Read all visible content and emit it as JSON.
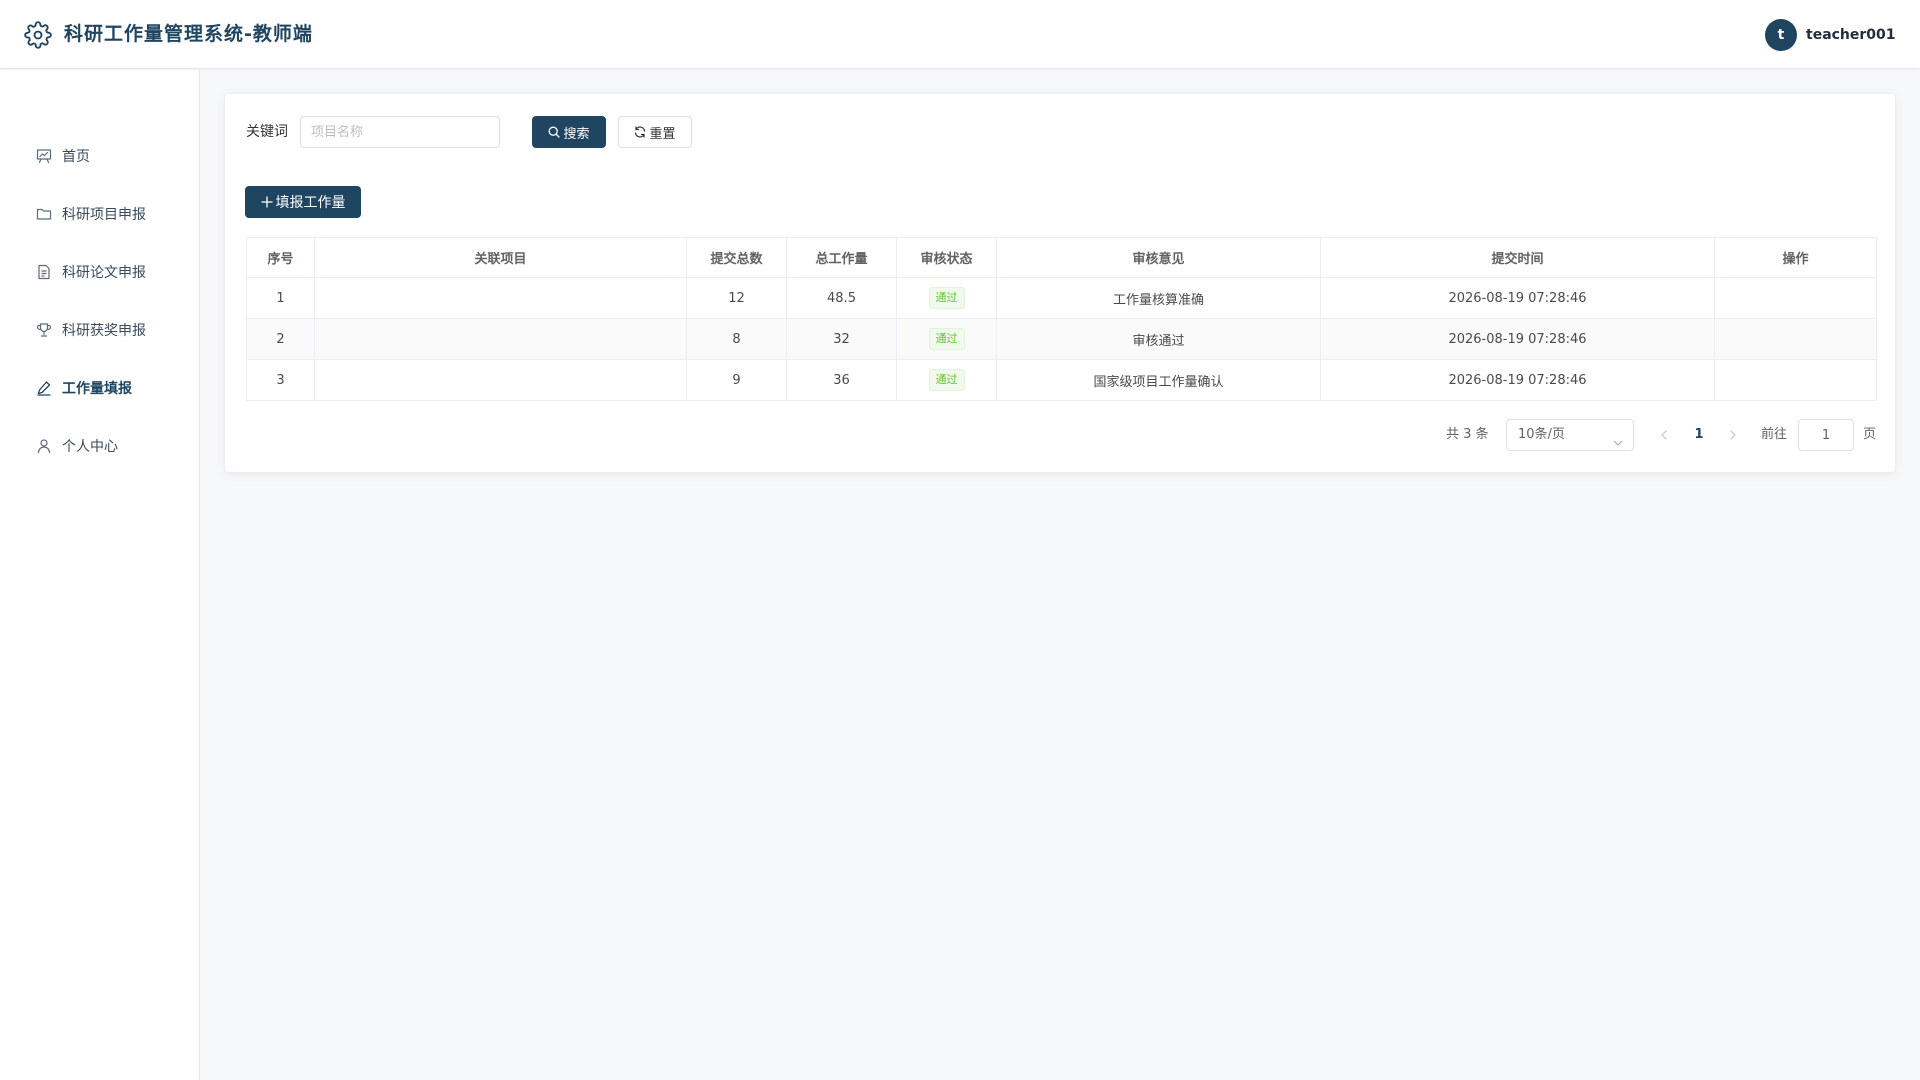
{
  "header": {
    "title": "科研工作量管理系统-教师端",
    "avatar_initial": "t",
    "username": "teacher001"
  },
  "sidebar": {
    "items": [
      {
        "label": "首页",
        "icon": "presentation-chart-icon"
      },
      {
        "label": "科研项目申报",
        "icon": "folder-icon"
      },
      {
        "label": "科研论文申报",
        "icon": "document-icon"
      },
      {
        "label": "科研获奖申报",
        "icon": "trophy-icon"
      },
      {
        "label": "工作量填报",
        "icon": "edit-pen-icon",
        "active": true
      },
      {
        "label": "个人中心",
        "icon": "user-icon"
      }
    ]
  },
  "search": {
    "label": "关键词",
    "placeholder": "项目名称",
    "value": "",
    "search_button": "搜索",
    "reset_button": "重置"
  },
  "toolbar": {
    "add_button": "填报工作量"
  },
  "table": {
    "columns": [
      "序号",
      "关联项目",
      "提交总数",
      "总工作量",
      "审核状态",
      "审核意见",
      "提交时间",
      "操作"
    ],
    "rows": [
      {
        "index": "1",
        "project": "",
        "total_submissions": "12",
        "total_workload": "48.5",
        "status": "通过",
        "opinion": "工作量核算准确",
        "time": "2026-08-19 07:28:46",
        "actions": ""
      },
      {
        "index": "2",
        "project": "",
        "total_submissions": "8",
        "total_workload": "32",
        "status": "通过",
        "opinion": "审核通过",
        "time": "2026-08-19 07:28:46",
        "actions": ""
      },
      {
        "index": "3",
        "project": "",
        "total_submissions": "9",
        "total_workload": "36",
        "status": "通过",
        "opinion": "国家级项目工作量确认",
        "time": "2026-08-19 07:28:46",
        "actions": ""
      }
    ]
  },
  "pagination": {
    "total_text": "共 3 条",
    "page_size": "10条/页",
    "current_page": "1",
    "goto_label": "前往",
    "goto_value": "1",
    "page_unit": "页"
  },
  "colors": {
    "primary": "#1f4560",
    "success": "#67c23a",
    "background": "#f7f8fa"
  }
}
